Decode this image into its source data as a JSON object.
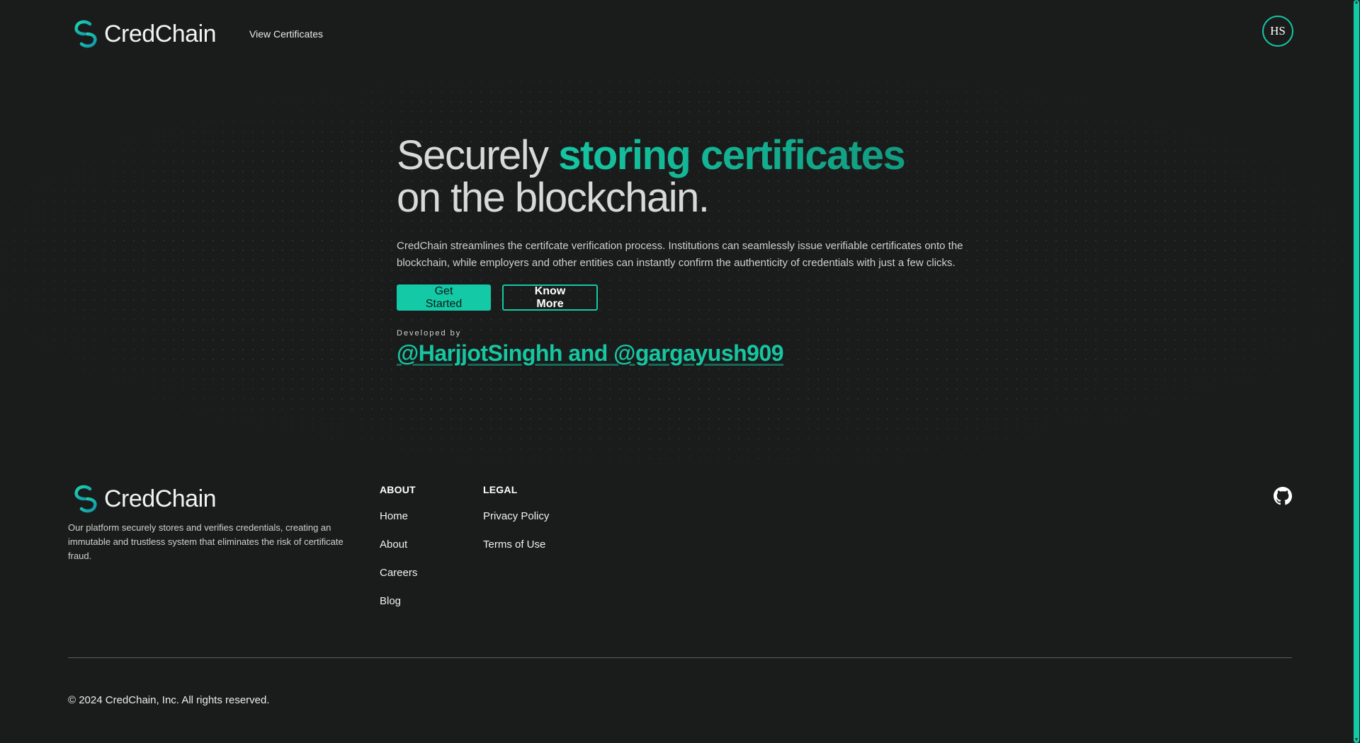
{
  "brand": {
    "name": "CredChain",
    "accent_color": "#14c9a5",
    "background_color": "#1a1c1c"
  },
  "header": {
    "nav_link": "View Certificates",
    "avatar_initials": "HS"
  },
  "hero": {
    "title_part1": "Securely ",
    "title_accent": "storing certificates",
    "title_part2": "on the blockchain.",
    "description": "CredChain streamlines the certifcate verification process. Institutions can seamlessly issue verifiable certificates onto the blockchain, while employers and other entities can instantly confirm the authenticity of credentials with just a few clicks.",
    "primary_button": "Get Started",
    "secondary_button": "Know More",
    "developed_by_label": "Developed by",
    "developers": "@HarjjotSinghh and @gargayush909"
  },
  "footer": {
    "description": "Our platform securely stores and verifies credentials, creating an immutable and trustless system that eliminates the risk of certificate fraud.",
    "columns": [
      {
        "title": "ABOUT",
        "links": [
          "Home",
          "About",
          "Careers",
          "Blog"
        ]
      },
      {
        "title": "LEGAL",
        "links": [
          "Privacy Policy",
          "Terms of Use"
        ]
      }
    ],
    "social_icon": "github-icon",
    "copyright": "© 2024 CredChain, Inc. All rights reserved."
  }
}
